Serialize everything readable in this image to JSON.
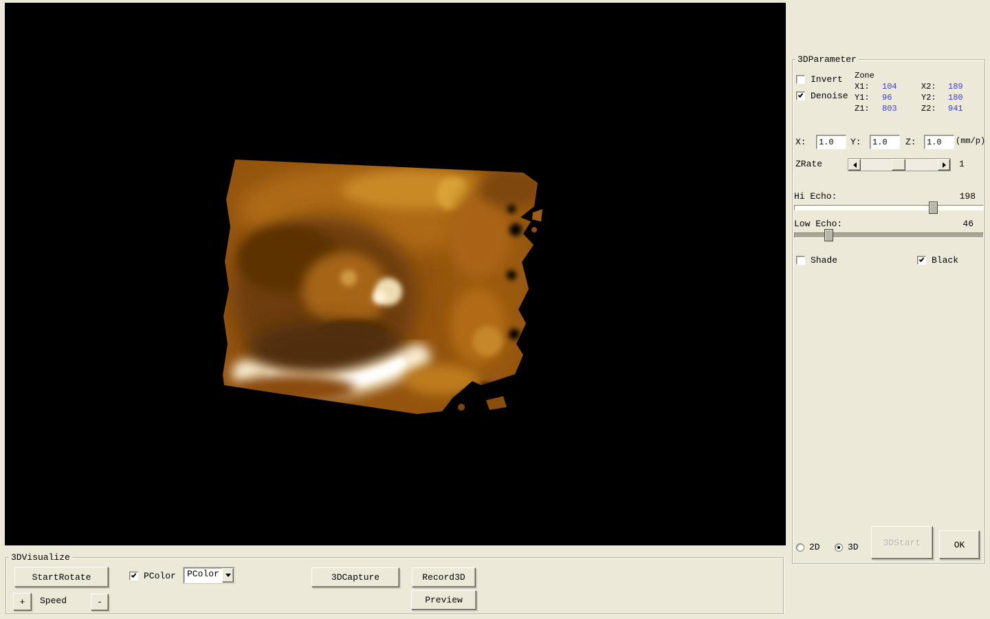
{
  "colors": {
    "window_bg": "#ece9d8",
    "viewport_bg": "#000000",
    "value_blue": "#3b3bd0",
    "volume_base_amber": "#94540e",
    "volume_dark_brown": "#5c3205",
    "volume_highlight_white": "#fff7e0"
  },
  "parameter_panel": {
    "title": "3DParameter",
    "invert": {
      "label": "Invert",
      "checked": false
    },
    "denoise": {
      "label": "Denoise",
      "checked": true
    },
    "zone": {
      "title": "Zone",
      "x1_label": "X1:",
      "x1_value": "104",
      "x2_label": "X2:",
      "x2_value": "189",
      "y1_label": "Y1:",
      "y1_value": "96",
      "y2_label": "Y2:",
      "y2_value": "180",
      "z1_label": "Z1:",
      "z1_value": "803",
      "z2_label": "Z2:",
      "z2_value": "941"
    },
    "scale": {
      "x_label": "X:",
      "x_value": "1.0",
      "y_label": "Y:",
      "y_value": "1.0",
      "z_label": "Z:",
      "z_value": "1.0",
      "unit": "(mm/p)"
    },
    "zrate": {
      "label": "ZRate",
      "value": "1"
    },
    "hi_echo": {
      "label": "Hi Echo:",
      "value": "198",
      "max": 255
    },
    "low_echo": {
      "label": "Low Echo:",
      "value": "46",
      "max": 255
    },
    "shade": {
      "label": "Shade",
      "checked": false
    },
    "black": {
      "label": "Black",
      "checked": true
    },
    "mode_2d": {
      "label": "2D",
      "selected": false
    },
    "mode_3d": {
      "label": "3D",
      "selected": true
    },
    "start3d_button": "3DStart",
    "ok_button": "OK"
  },
  "visualize_panel": {
    "title": "3DVisualize",
    "start_rotate_button": "StartRotate",
    "speed_plus_button": "+",
    "speed_label": "Speed",
    "speed_minus_button": "-",
    "pcolor": {
      "label": "PColor",
      "checked": true
    },
    "pcolor_select": {
      "value": "PColor"
    },
    "capture_button": "3DCapture",
    "record_button": "Record3D",
    "preview_button": "Preview"
  }
}
